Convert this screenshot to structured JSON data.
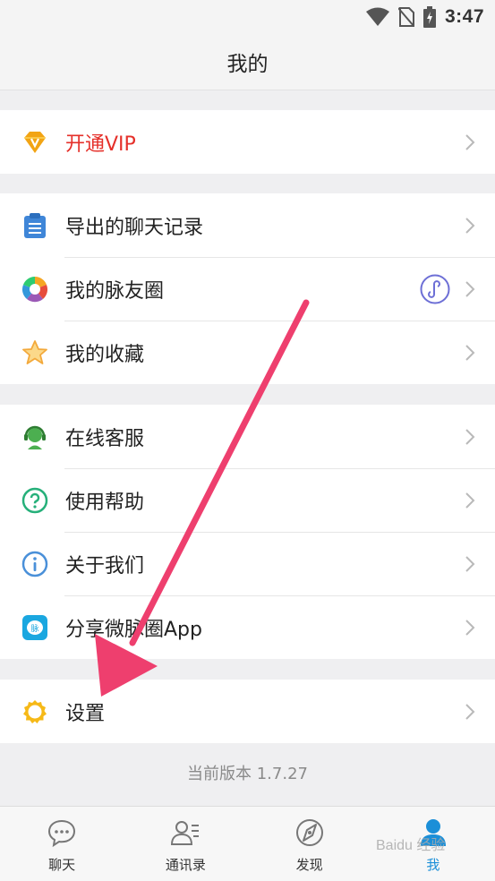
{
  "status": {
    "time": "3:47"
  },
  "header": {
    "title": "我的"
  },
  "groups": {
    "vip": {
      "label": "开通VIP"
    },
    "records": {
      "label": "导出的聊天记录"
    },
    "circle": {
      "label": "我的脉友圈"
    },
    "favorites": {
      "label": "我的收藏"
    },
    "service": {
      "label": "在线客服"
    },
    "help": {
      "label": "使用帮助"
    },
    "about": {
      "label": "关于我们"
    },
    "share": {
      "label": "分享微脉圈App"
    },
    "settings": {
      "label": "设置"
    }
  },
  "version": "当前版本 1.7.27",
  "tabs": [
    {
      "label": "聊天",
      "icon": "chat-icon",
      "active": false
    },
    {
      "label": "通讯录",
      "icon": "contacts-icon",
      "active": false
    },
    {
      "label": "发现",
      "icon": "discover-icon",
      "active": false
    },
    {
      "label": "我",
      "icon": "me-icon",
      "active": true
    }
  ],
  "watermark": "Baidu 经验",
  "colors": {
    "vip_text": "#e5302a",
    "active_tab": "#1b8fd8",
    "annotation_arrow": "#ee3f6e"
  }
}
